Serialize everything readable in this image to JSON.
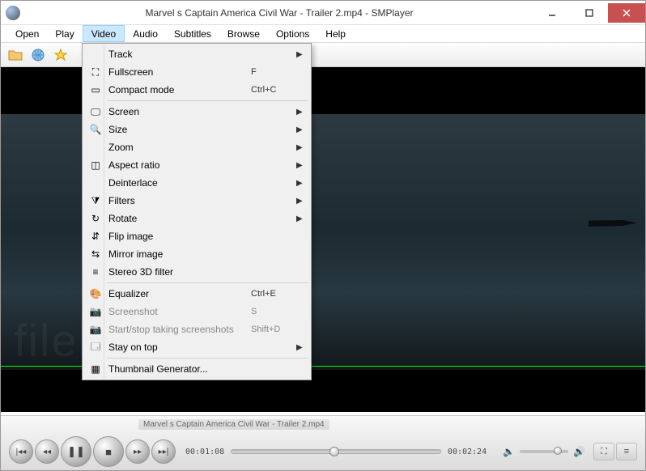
{
  "window": {
    "title": "Marvel s Captain America  Civil War - Trailer 2.mp4 - SMPlayer"
  },
  "menubar": {
    "items": [
      "Open",
      "Play",
      "Video",
      "Audio",
      "Subtitles",
      "Browse",
      "Options",
      "Help"
    ],
    "active_index": 2
  },
  "toolbar_icons": [
    "folder-icon",
    "globe-icon",
    "favorites-icon"
  ],
  "video_dropdown": [
    {
      "icon": "",
      "label": "Track",
      "shortcut": "",
      "submenu": true
    },
    {
      "icon": "⛶",
      "label": "Fullscreen",
      "shortcut": "F"
    },
    {
      "icon": "▭",
      "label": "Compact mode",
      "shortcut": "Ctrl+C"
    },
    {
      "sep": true
    },
    {
      "icon": "🖵",
      "label": "Screen",
      "submenu": true
    },
    {
      "icon": "🔍",
      "label": "Size",
      "submenu": true
    },
    {
      "icon": "",
      "label": "Zoom",
      "submenu": true
    },
    {
      "icon": "◫",
      "label": "Aspect ratio",
      "submenu": true
    },
    {
      "icon": "",
      "label": "Deinterlace",
      "submenu": true
    },
    {
      "icon": "⧩",
      "label": "Filters",
      "submenu": true
    },
    {
      "icon": "↻",
      "label": "Rotate",
      "submenu": true
    },
    {
      "icon": "⇵",
      "label": "Flip image"
    },
    {
      "icon": "⇆",
      "label": "Mirror image"
    },
    {
      "icon": "≡",
      "label": "Stereo 3D filter"
    },
    {
      "sep": true
    },
    {
      "icon": "🎨",
      "label": "Equalizer",
      "shortcut": "Ctrl+E"
    },
    {
      "icon": "📷",
      "label": "Screenshot",
      "shortcut": "S",
      "disabled": true
    },
    {
      "icon": "📷",
      "label": "Start/stop taking screenshots",
      "shortcut": "Shift+D",
      "disabled": true
    },
    {
      "icon": "🗔",
      "label": "Stay on top",
      "submenu": true
    },
    {
      "sep": true
    },
    {
      "icon": "▦",
      "label": "Thumbnail Generator..."
    }
  ],
  "playback": {
    "track_label": "Marvel s Captain America  Civil War - Trailer 2.mp4",
    "elapsed": "00:01:08",
    "total": "00:02:24",
    "progress_pct": 47,
    "volume_pct": 70
  },
  "watermark": "filehorse"
}
